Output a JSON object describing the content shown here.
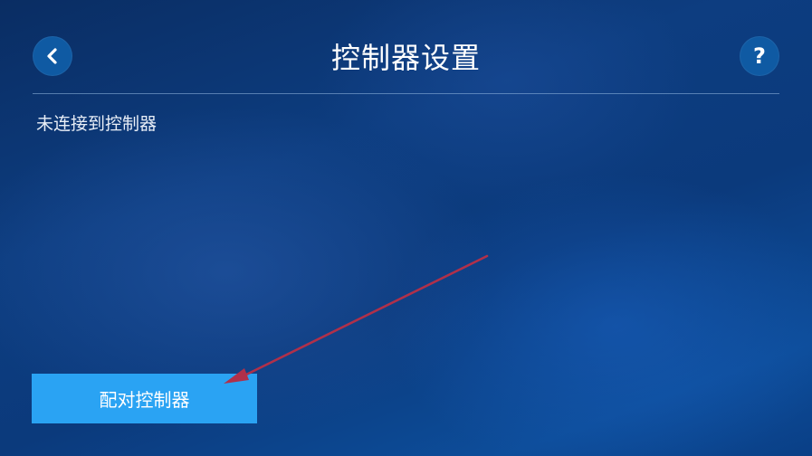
{
  "header": {
    "title": "控制器设置",
    "back_icon": "chevron-left-icon",
    "help_icon": "help-icon",
    "help_glyph": "?"
  },
  "main": {
    "status_text": "未连接到控制器",
    "pair_button_label": "配对控制器"
  },
  "colors": {
    "button_blue": "#2aa3f3",
    "circle_button": "#0f5aa3",
    "annotation_arrow": "#b0304a"
  }
}
